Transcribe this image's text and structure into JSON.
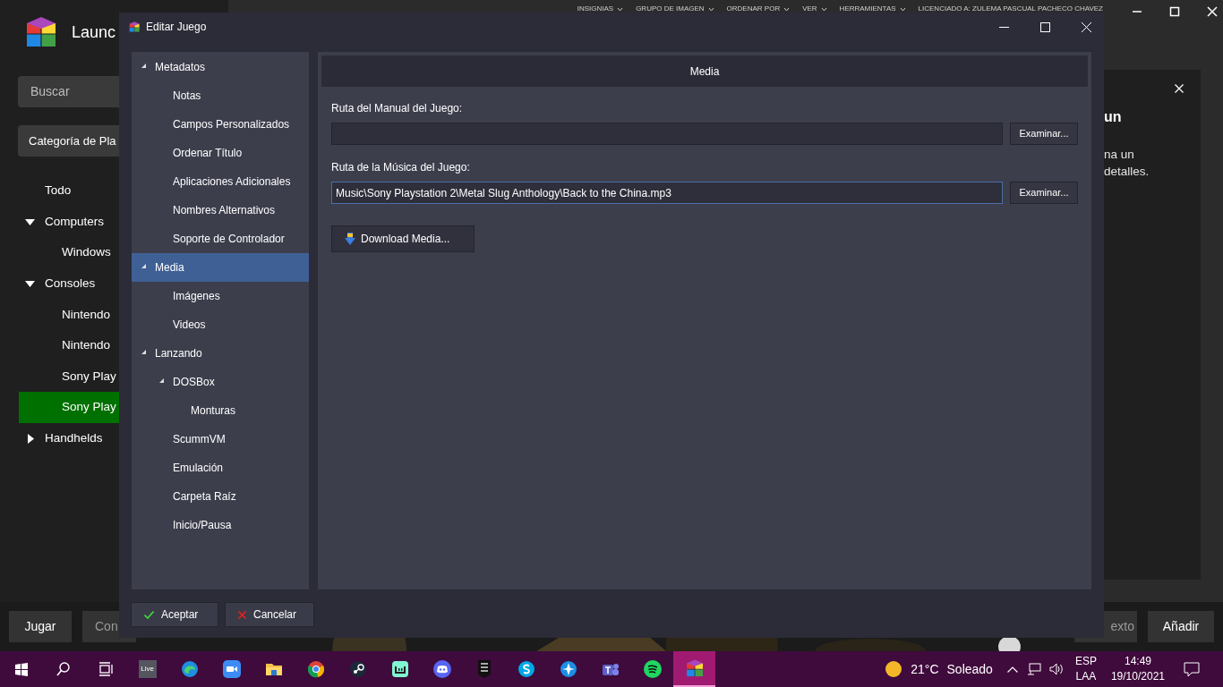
{
  "launcher": {
    "title": "Launc",
    "menu": [
      "INSIGNIAS",
      "GRUPO DE IMAGEN",
      "ORDENAR POR",
      "VER",
      "HERRAMIENTAS"
    ],
    "license": "LICENCIADO A: ZULEMA PASCUAL PACHECO CHAVEZ",
    "search": {
      "placeholder": "Buscar"
    },
    "category": "Categoría de Pla",
    "platforms": [
      {
        "label": "Todo",
        "selected": false
      },
      {
        "label": "Computers",
        "selected": false,
        "expanded": true,
        "children": [
          {
            "label": "Windows",
            "selected": false
          }
        ]
      },
      {
        "label": "Consoles",
        "selected": false,
        "expanded": true,
        "children": [
          {
            "label": "Nintendo",
            "selected": false
          },
          {
            "label": "Nintendo",
            "selected": false
          },
          {
            "label": "Sony Play",
            "selected": false
          },
          {
            "label": "Sony Play",
            "selected": true
          }
        ]
      },
      {
        "label": "Handhelds",
        "selected": false,
        "expanded": false
      }
    ],
    "side_panel": {
      "title": "un",
      "lines": [
        "na un",
        "detalles."
      ]
    },
    "left_buttons": [
      "Jugar",
      "Con"
    ],
    "right_buttons": [
      "exto",
      "Añadir"
    ]
  },
  "dialog": {
    "title": "Editar Juego",
    "tree": [
      {
        "label": "Metadatos",
        "selected": false,
        "expanded": true,
        "children": [
          {
            "label": "Notas",
            "selected": false
          },
          {
            "label": "Campos Personalizados",
            "selected": false
          },
          {
            "label": "Ordenar Título",
            "selected": false
          },
          {
            "label": "Aplicaciones Adicionales",
            "selected": false
          },
          {
            "label": "Nombres Alternativos",
            "selected": false
          },
          {
            "label": "Soporte de Controlador",
            "selected": false
          }
        ]
      },
      {
        "label": "Media",
        "selected": true,
        "expanded": true,
        "children": [
          {
            "label": "Imágenes",
            "selected": false
          },
          {
            "label": "Videos",
            "selected": false
          }
        ]
      },
      {
        "label": "Lanzando",
        "selected": false,
        "expanded": true,
        "children": [
          {
            "label": "DOSBox",
            "selected": false,
            "expanded": true,
            "children": [
              {
                "label": "Monturas",
                "selected": false
              }
            ]
          },
          {
            "label": "ScummVM",
            "selected": false
          },
          {
            "label": "Emulación",
            "selected": false
          },
          {
            "label": "Carpeta Raíz",
            "selected": false
          },
          {
            "label": "Inicio/Pausa",
            "selected": false
          }
        ]
      }
    ],
    "section_title": "Media",
    "fields": [
      {
        "label": "Ruta del Manual del Juego:",
        "focused": false,
        "button": "Examinar..."
      },
      {
        "label": "Ruta de la Música del Juego:",
        "value": "Music\\Sony Playstation 2\\Metal Slug Anthology\\Back to the China.mp3",
        "focused": true,
        "button": "Examinar..."
      }
    ],
    "download_button": "Download Media...",
    "buttons": [
      {
        "kind": "ok",
        "label": "Aceptar"
      },
      {
        "kind": "cancel",
        "label": "Cancelar"
      }
    ]
  },
  "taskbar": {
    "apps": [
      {
        "kind": "start",
        "selected": false
      },
      {
        "kind": "search",
        "selected": false
      },
      {
        "kind": "taskview",
        "selected": false
      },
      {
        "kind": "live",
        "label": "Live",
        "selected": false
      },
      {
        "kind": "swirl",
        "selected": false
      },
      {
        "kind": "camera",
        "selected": false
      },
      {
        "kind": "folder",
        "selected": false
      },
      {
        "kind": "ring",
        "selected": false
      },
      {
        "kind": "steam",
        "selected": false
      },
      {
        "kind": "stream",
        "selected": false
      },
      {
        "kind": "chat",
        "selected": false
      },
      {
        "kind": "epic",
        "selected": false
      },
      {
        "kind": "skype",
        "selected": false
      },
      {
        "kind": "star",
        "selected": false
      },
      {
        "kind": "team",
        "selected": false
      },
      {
        "kind": "waves",
        "selected": false
      },
      {
        "kind": "cube",
        "selected": true
      }
    ],
    "weather": {
      "temperature": "21°C",
      "condition": "Soleado"
    },
    "language": [
      "ESP",
      "LAA"
    ],
    "time": "14:49",
    "date": "19/10/2021"
  }
}
